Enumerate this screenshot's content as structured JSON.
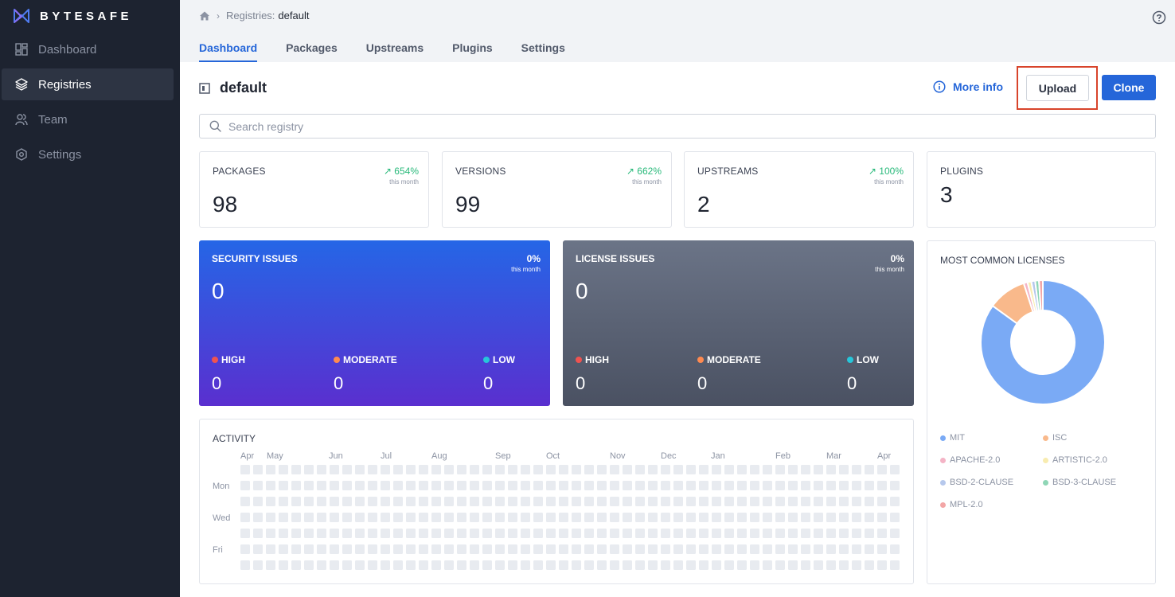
{
  "brand": {
    "name": "BYTESAFE"
  },
  "sidebar": {
    "items": [
      {
        "label": "Dashboard",
        "icon": "dashboard-icon",
        "active": false
      },
      {
        "label": "Registries",
        "icon": "layers-icon",
        "active": true
      },
      {
        "label": "Team",
        "icon": "team-icon",
        "active": false
      },
      {
        "label": "Settings",
        "icon": "gear-icon",
        "active": false
      }
    ]
  },
  "breadcrumb": {
    "parent": "Registries:",
    "current": "default"
  },
  "tabs": [
    {
      "label": "Dashboard",
      "active": true
    },
    {
      "label": "Packages",
      "active": false
    },
    {
      "label": "Upstreams",
      "active": false
    },
    {
      "label": "Plugins",
      "active": false
    },
    {
      "label": "Settings",
      "active": false
    }
  ],
  "registry": {
    "name": "default"
  },
  "actions": {
    "more_info": "More info",
    "upload": "Upload",
    "clone": "Clone"
  },
  "search": {
    "placeholder": "Search registry"
  },
  "stats": [
    {
      "label": "PACKAGES",
      "value": "98",
      "trend": "654%",
      "trend_sub": "this month"
    },
    {
      "label": "VERSIONS",
      "value": "99",
      "trend": "662%",
      "trend_sub": "this month"
    },
    {
      "label": "UPSTREAMS",
      "value": "2",
      "trend": "100%",
      "trend_sub": "this month"
    },
    {
      "label": "PLUGINS",
      "value": "3",
      "trend": "",
      "trend_sub": ""
    }
  ],
  "security": {
    "title": "SECURITY ISSUES",
    "value": "0",
    "pct": "0%",
    "pct_sub": "this month",
    "high_label": "HIGH",
    "high": "0",
    "moderate_label": "MODERATE",
    "moderate": "0",
    "low_label": "LOW",
    "low": "0"
  },
  "license_issues": {
    "title": "LICENSE ISSUES",
    "value": "0",
    "pct": "0%",
    "pct_sub": "this month",
    "high_label": "HIGH",
    "high": "0",
    "moderate_label": "MODERATE",
    "moderate": "0",
    "low_label": "LOW",
    "low": "0"
  },
  "colors": {
    "accent": "#2566d9",
    "high": "#ef5350",
    "moderate": "#ff8a50",
    "low": "#26c6da",
    "trend_up": "#28b97a",
    "activity_empty": "#e8ebf0",
    "activity_active": "#0f4a3a"
  },
  "licenses": {
    "title": "MOST COMMON LICENSES",
    "items": [
      {
        "name": "MIT",
        "color": "#7aaaf5"
      },
      {
        "name": "ISC",
        "color": "#f9b98b"
      },
      {
        "name": "APACHE-2.0",
        "color": "#f4b4c6"
      },
      {
        "name": "ARTISTIC-2.0",
        "color": "#f8ecb0"
      },
      {
        "name": "BSD-2-CLAUSE",
        "color": "#b6c8ec"
      },
      {
        "name": "BSD-3-CLAUSE",
        "color": "#8fd6b6"
      },
      {
        "name": "MPL-2.0",
        "color": "#f3a6a6"
      }
    ]
  },
  "chart_data": {
    "type": "pie",
    "style": "donut",
    "categories": [
      "MIT",
      "ISC",
      "APACHE-2.0",
      "ARTISTIC-2.0",
      "BSD-2-CLAUSE",
      "BSD-3-CLAUSE",
      "MPL-2.0"
    ],
    "values": [
      85,
      10,
      1,
      1,
      1,
      1,
      1
    ],
    "colors": [
      "#7aaaf5",
      "#f9b98b",
      "#f4b4c6",
      "#f8ecb0",
      "#b6c8ec",
      "#8fd6b6",
      "#f3a6a6"
    ],
    "title": "MOST COMMON LICENSES",
    "legend": "bottom"
  },
  "activity": {
    "title": "ACTIVITY",
    "months": [
      "Apr",
      "May",
      "Jun",
      "Jul",
      "Aug",
      "Sep",
      "Oct",
      "Nov",
      "Dec",
      "Jan",
      "Feb",
      "Mar",
      "Apr"
    ],
    "days": [
      "Mon",
      "Wed",
      "Fri"
    ],
    "weeks": 53,
    "active_cells": [
      {
        "week": 52,
        "day": 3
      }
    ]
  }
}
